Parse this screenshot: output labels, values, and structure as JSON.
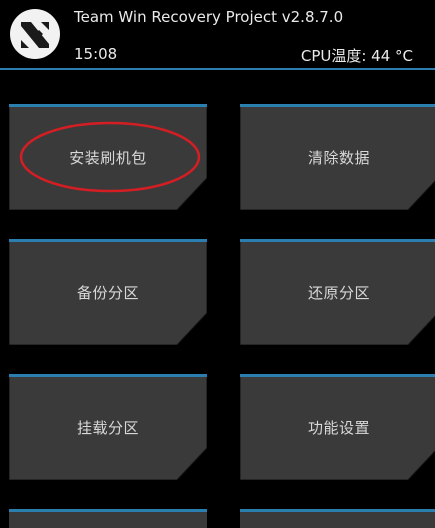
{
  "header": {
    "title": "Team Win Recovery Project  v2.8.7.0",
    "time": "15:08",
    "cpu_temp": "CPU温度: 44 °C"
  },
  "tiles": [
    {
      "label": "安装刷机包"
    },
    {
      "label": "清除数据"
    },
    {
      "label": "备份分区"
    },
    {
      "label": "还原分区"
    },
    {
      "label": "挂载分区"
    },
    {
      "label": "功能设置"
    }
  ],
  "colors": {
    "accent": "#2a7fb0",
    "tile_bg": "#3a3a3a",
    "highlight": "#d51e23"
  },
  "icons": [
    "twrp-logo-icon"
  ]
}
